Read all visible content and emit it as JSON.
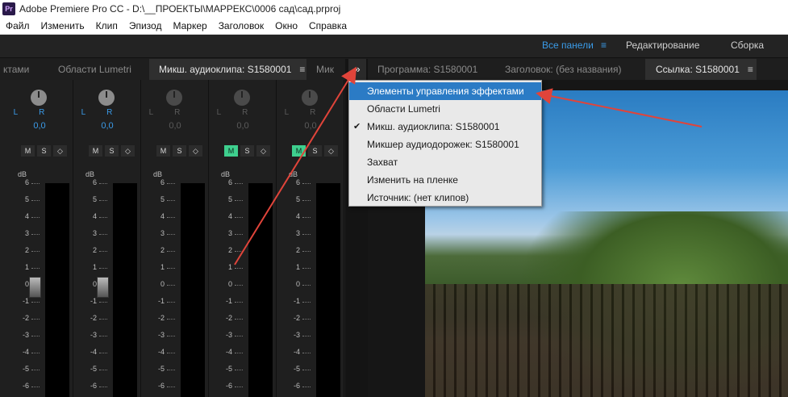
{
  "titlebar": {
    "app_icon": "Pr",
    "title": "Adobe Premiere Pro CC - D:\\__ПРОЕКТЫ\\МАРРЕКС\\0006 сад\\сад.prproj"
  },
  "menu": [
    "Файл",
    "Изменить",
    "Клип",
    "Эпизод",
    "Маркер",
    "Заголовок",
    "Окно",
    "Справка"
  ],
  "workspace": {
    "all_panels": "Все панели",
    "all_panels_menu_icon": "≡",
    "edit": "Редактирование",
    "assembly": "Сборка"
  },
  "left_tabs": {
    "tab1": "ктами",
    "tab2": "Области Lumetri",
    "tab3": "Микш. аудиоклипа: S1580001",
    "tab3_menu": "≡",
    "tab4": "Мик"
  },
  "overflow_button": "»",
  "right_tabs": {
    "tab1": "Программа: S1580001",
    "tab2": "Заголовок: (без названия)",
    "tab3": "Ссылка: S1580001",
    "tab3_menu": "≡"
  },
  "dropdown": {
    "items": [
      {
        "label": "Элементы управления эффектами",
        "checked": ""
      },
      {
        "label": "Области Lumetri",
        "checked": ""
      },
      {
        "label": "Микш. аудиоклипа: S1580001",
        "checked": "✔"
      },
      {
        "label": "Микшер аудиодорожек: S1580001",
        "checked": ""
      },
      {
        "label": "Захват",
        "checked": ""
      },
      {
        "label": "Изменить на пленке",
        "checked": ""
      },
      {
        "label": "Источник: (нет клипов)",
        "checked": ""
      }
    ]
  },
  "mixer": {
    "lr": "LR",
    "pan": "0,0",
    "buttons": {
      "m": "M",
      "s": "S",
      "k": "◇"
    },
    "db": "dB",
    "scale": [
      "6",
      "5",
      "4",
      "3",
      "2",
      "1",
      "0",
      "-1",
      "-2",
      "-3",
      "-4",
      "-5",
      "-6"
    ]
  },
  "colors": {
    "accent": "#3a9be8",
    "mute_on": "#3ecf8e",
    "highlight": "#2b7bc5",
    "arrow": "#e0443a"
  }
}
